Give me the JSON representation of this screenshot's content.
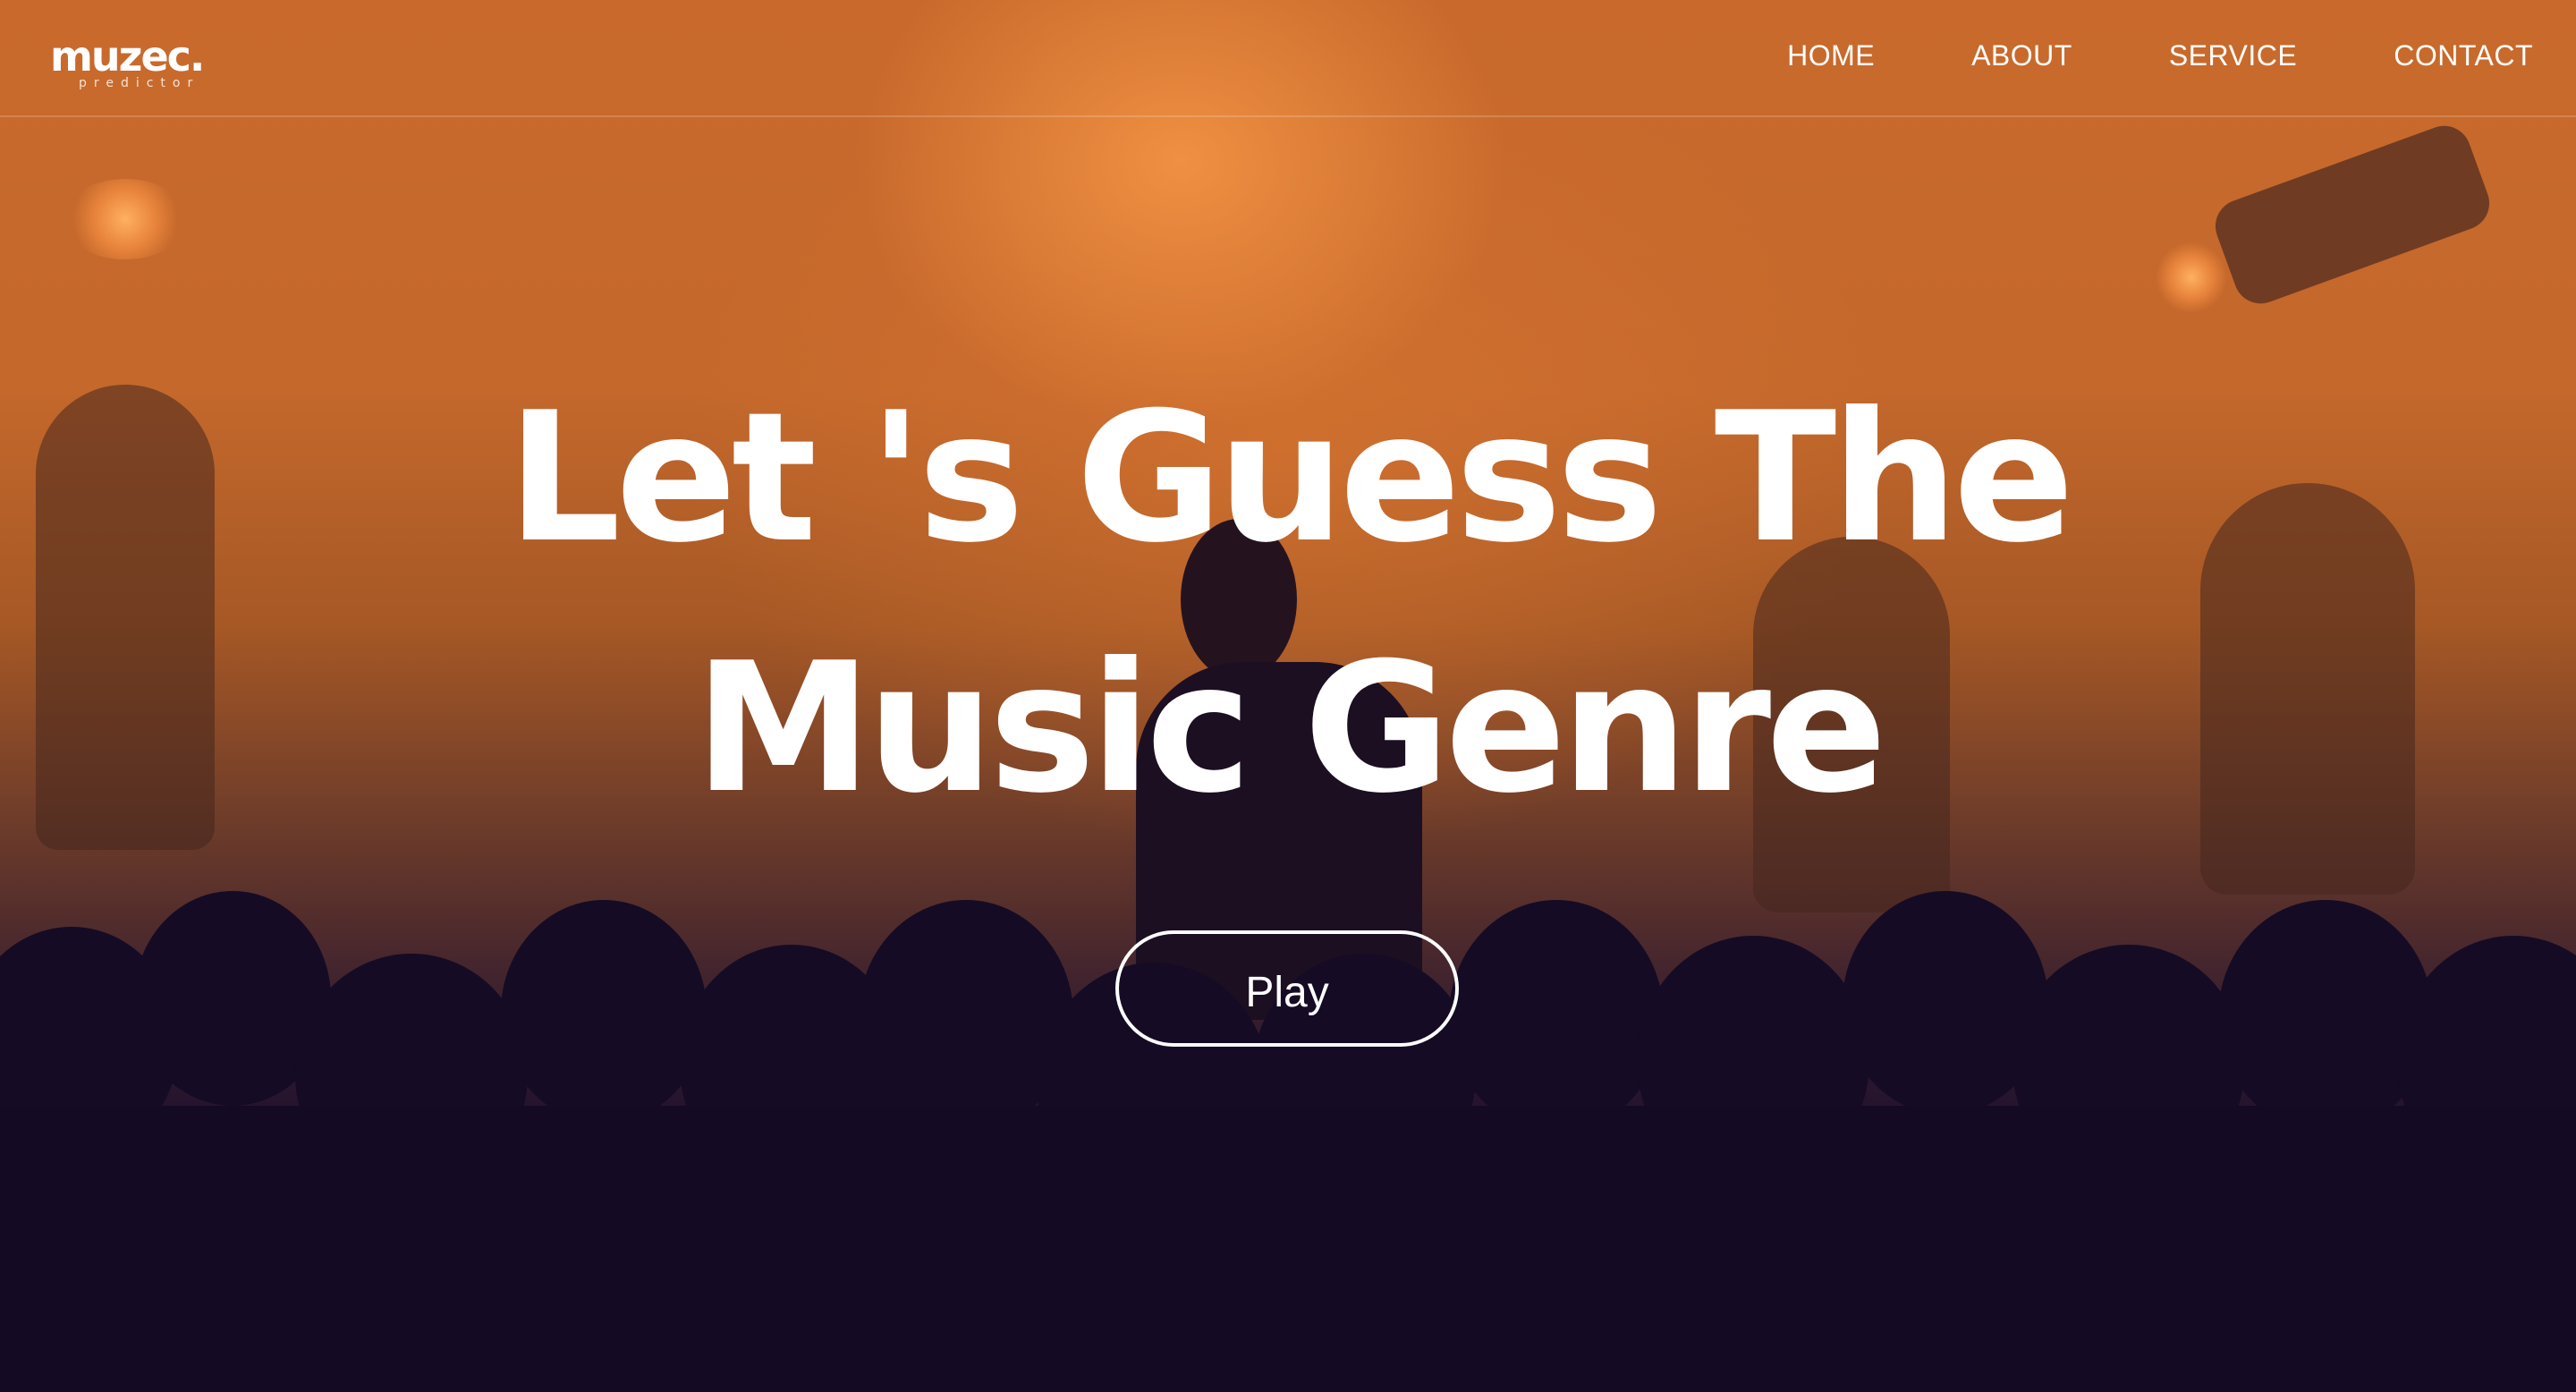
{
  "brand": {
    "name": "muzec.",
    "tagline": "predictor"
  },
  "nav": {
    "items": [
      {
        "label": "HOME"
      },
      {
        "label": "ABOUT"
      },
      {
        "label": "SERVICE"
      },
      {
        "label": "CONTACT"
      }
    ]
  },
  "hero": {
    "title_line_1": "Let 's Guess The",
    "title_line_2": "Music Genre",
    "cta_label": "Play"
  },
  "colors": {
    "overlay_top": "#c96a2c",
    "overlay_bottom": "#120a24",
    "text": "#ffffff"
  }
}
